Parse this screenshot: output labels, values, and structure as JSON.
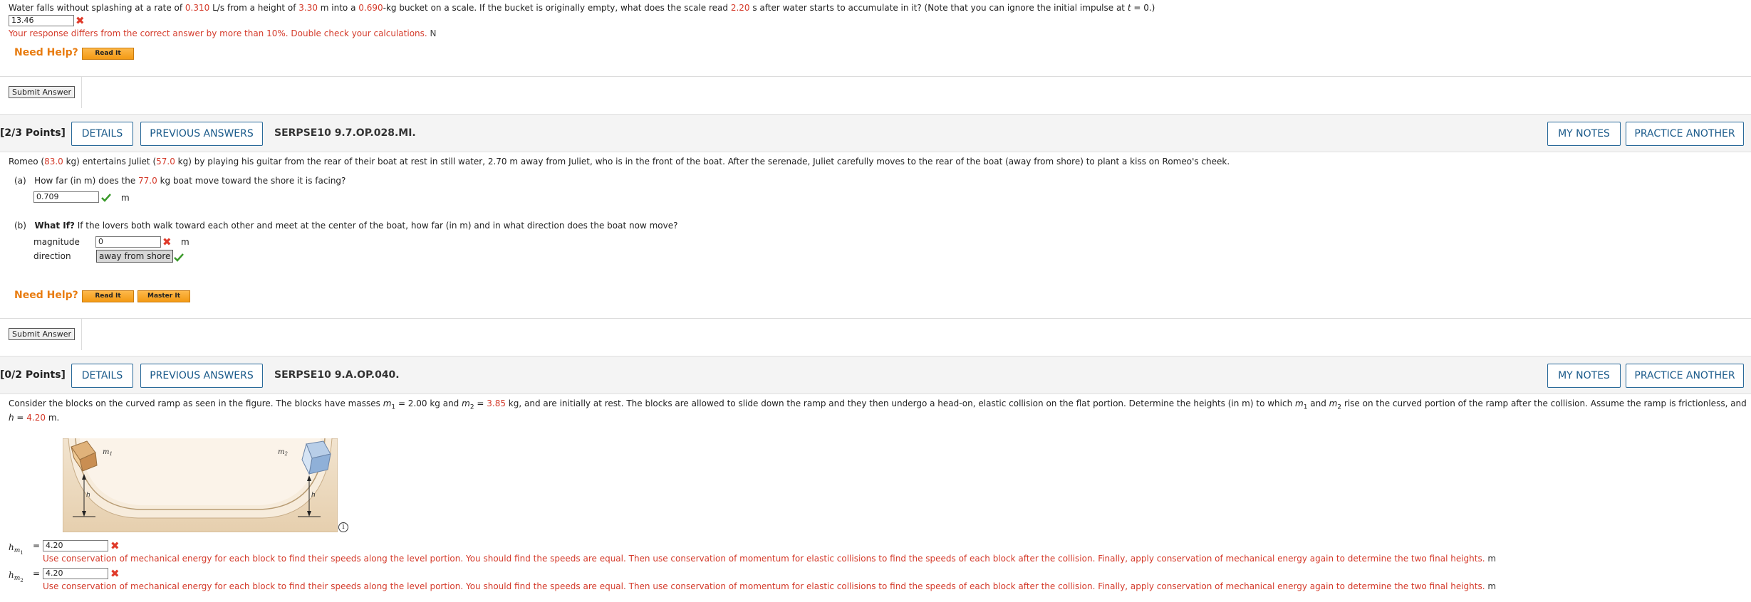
{
  "q1": {
    "text_pre": "Water falls without splashing at a rate of ",
    "rate": "0.310",
    "text_a": " L/s from a height of ",
    "height": "3.30",
    "text_b": " m into a ",
    "mass": "0.690",
    "text_c": "-kg bucket on a scale. If the bucket is originally empty, what does the scale read ",
    "time": "2.20",
    "text_d": " s after water starts to accumulate in it? (Note that you can ignore the initial impulse at ",
    "t_var": "t",
    "text_e": " = 0.)",
    "answer": "13.46",
    "feedback": "Your response differs from the correct answer by more than 10%. Double check your calculations.",
    "unit": "N",
    "need_help": "Need Help?",
    "read_it": "Read It",
    "submit": "Submit Answer"
  },
  "q2": {
    "points": "[2/3 Points]",
    "details": "DETAILS",
    "previous_answers": "PREVIOUS ANSWERS",
    "code": "SERPSE10 9.7.OP.028.MI.",
    "my_notes": "MY NOTES",
    "practice_another": "PRACTICE ANOTHER",
    "stem_pre": "Romeo (",
    "romeo_mass": "83.0",
    "stem_a": " kg) entertains Juliet (",
    "juliet_mass": "57.0",
    "stem_b": " kg) by playing his guitar from the rear of their boat at rest in still water, 2.70 m away from Juliet, who is in the front of the boat. After the serenade, Juliet carefully moves to the rear of the boat (away from shore) to plant a kiss on Romeo's cheek.",
    "part_a_label": "(a)",
    "part_a_pre": "How far (in m) does the ",
    "boat_mass": "77.0",
    "part_a_post": " kg boat move toward the shore it is facing?",
    "part_a_answer": "0.709",
    "part_a_unit": "m",
    "part_b_label": "(b)",
    "part_b_bold": "What If?",
    "part_b_text": " If the lovers both walk toward each other and meet at the center of the boat, how far (in m) and in what direction does the boat now move?",
    "magnitude_label": "magnitude",
    "magnitude_answer": "0",
    "magnitude_unit": "m",
    "direction_label": "direction",
    "direction_answer": "away from shore",
    "need_help": "Need Help?",
    "read_it": "Read It",
    "master_it": "Master It",
    "submit": "Submit Answer"
  },
  "q3": {
    "points": "[0/2 Points]",
    "details": "DETAILS",
    "previous_answers": "PREVIOUS ANSWERS",
    "code": "SERPSE10 9.A.OP.040.",
    "my_notes": "MY NOTES",
    "practice_another": "PRACTICE ANOTHER",
    "stem_pre": "Consider the blocks on the curved ramp as seen in the figure. The blocks have masses ",
    "m1_sym": "m",
    "m1_sub": "1",
    "m1_eq": " = 2.00 kg and ",
    "m2_sym": "m",
    "m2_sub": "2",
    "m2_eq": " = ",
    "m2_val": "3.85",
    "stem_a": " kg, and are initially at rest. The blocks are allowed to slide down the ramp and they then undergo a head-on, elastic collision on the flat portion. Determine the heights (in m) to which ",
    "stem_m1": "m",
    "stem_m1_sub": "1",
    "stem_and": " and ",
    "stem_m2": "m",
    "stem_m2_sub": "2",
    "stem_b": " rise on the curved portion of the ramp after the collision. Assume the ramp is frictionless, and",
    "h_line_pre": "h",
    "h_line_eq": " = ",
    "h_val": "4.20",
    "h_line_post": " m.",
    "fig_m1": "m",
    "fig_m1_sub": "1",
    "fig_m2": "m",
    "fig_m2_sub": "2",
    "fig_h": "h",
    "info_icon": "i",
    "h1_var": "h",
    "h1_sub": "m",
    "h1_subsub": "1",
    "h1_eq": "=",
    "h1_answer": "4.20",
    "h2_var": "h",
    "h2_sub": "m",
    "h2_subsub": "2",
    "h2_eq": "=",
    "h2_answer": "4.20",
    "hint": "Use conservation of mechanical energy for each block to find their speeds along the level portion. You should find the speeds are equal. Then use conservation of momentum for elastic collisions to find the speeds of each block after the collision. Finally, apply conservation of mechanical energy again to determine the two final heights.",
    "hint_unit": "m"
  },
  "colors": {
    "red": "#d43a2a",
    "green": "#3a9a2a",
    "orange": "#e87c10",
    "blue_button": "#1a5a8a"
  }
}
